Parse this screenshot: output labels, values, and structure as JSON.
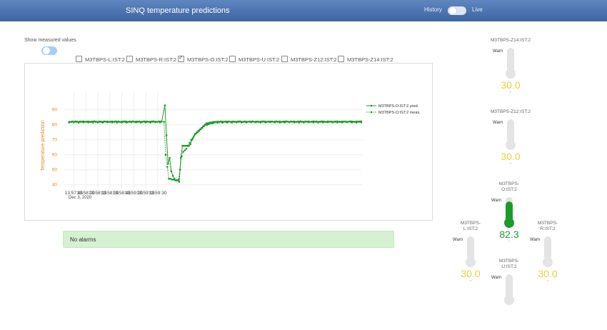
{
  "header": {
    "title": "SINQ temperature predictions",
    "mode_left": "History",
    "mode_right": "Live"
  },
  "controls": {
    "show_measured_label": "Show measured values",
    "show_measured_on": true,
    "sensors": [
      {
        "label": "M3TBPS-L:IST:2",
        "checked": false
      },
      {
        "label": "M3TBPS-R:IST:2",
        "checked": false
      },
      {
        "label": "M3TBPS-O:IST:2",
        "checked": true
      },
      {
        "label": "M3TBPS-U:IST:2",
        "checked": false
      },
      {
        "label": "M3TBPS-Z12:IST:2",
        "checked": false
      },
      {
        "label": "M3TBPS-Z14:IST:2",
        "checked": false
      }
    ]
  },
  "chart_data": {
    "type": "line",
    "ylabel": "Temperature prediction",
    "ylim": [
      37,
      97
    ],
    "yticks": [
      "40",
      "50",
      "60",
      "70",
      "80",
      "90"
    ],
    "xticks": [
      "13:57:45",
      "13:58:00",
      "13:58:15",
      "13:58:30",
      "13:58:45",
      "13:59:00",
      "13:59:15",
      "13:59:30"
    ],
    "xdate": "Dec 3, 2020",
    "x_unit": "seconds after 13:57:45",
    "grid": true,
    "legend_position": "top-right",
    "series_color": "#1e9a2a",
    "series": [
      {
        "name": "M3TBPS-O:IST:2 pred.",
        "style": "solid",
        "x": [
          -6,
          -4,
          -2,
          0,
          2,
          4,
          6,
          8,
          10,
          12,
          14,
          16,
          18,
          20,
          22,
          24,
          26,
          28,
          30,
          32,
          34,
          36,
          38,
          40,
          42,
          44,
          46,
          48,
          50,
          52,
          54,
          56,
          58,
          60,
          62,
          64,
          66,
          68,
          70,
          72,
          74,
          76,
          78,
          80,
          82,
          84,
          86,
          88,
          90,
          92,
          94,
          96,
          98,
          100,
          102,
          104,
          106,
          108,
          110,
          114,
          116,
          118,
          120,
          122,
          124,
          126,
          128,
          130,
          132,
          134,
          136,
          138,
          140,
          142,
          144,
          146,
          148,
          150,
          152,
          154,
          156,
          158,
          160,
          162,
          164,
          166,
          168,
          170,
          172,
          174,
          176,
          178,
          180,
          182,
          184,
          186,
          188,
          190,
          192,
          194,
          196,
          198,
          200,
          202,
          204,
          206,
          208,
          210,
          212,
          214,
          216,
          218,
          220,
          222,
          224,
          226,
          228,
          230,
          232,
          234,
          236,
          238,
          240,
          242,
          244,
          246,
          248,
          250,
          252,
          254,
          256,
          258,
          260,
          262,
          264,
          266,
          268,
          270,
          272,
          274,
          276,
          278,
          280,
          282,
          284,
          286,
          288,
          290,
          292,
          294,
          296,
          298,
          300,
          302,
          304,
          306,
          308,
          310,
          312,
          314,
          316,
          318,
          320,
          322,
          324,
          326,
          328,
          330,
          332,
          334,
          336,
          338,
          340,
          342,
          344,
          346,
          348,
          350,
          352,
          354,
          356,
          358,
          360
        ],
        "values": [
          82,
          82,
          82.2,
          82,
          82.3,
          82.1,
          82,
          82.2,
          82.1,
          82.3,
          82,
          82.1,
          82.2,
          82,
          82.1,
          82.2,
          82.3,
          82.1,
          82,
          82.2,
          82.1,
          82,
          82.3,
          82.1,
          82.2,
          82,
          82.1,
          82.2,
          82,
          82.3,
          82.1,
          82.2,
          82.0,
          82.1,
          82.2,
          82.3,
          82.1,
          82,
          82.2,
          82.1,
          82.3,
          82,
          82.2,
          82.1,
          82.2,
          82,
          82.1,
          82.3,
          82.1,
          82.2,
          82,
          82.1,
          82.2,
          82.3,
          82.1,
          82,
          82.2,
          82.1,
          82.2,
          93,
          73,
          54,
          58,
          49,
          46,
          44,
          43,
          43,
          42,
          58,
          66,
          66,
          66,
          66,
          66,
          67,
          70,
          72,
          74,
          75,
          76,
          77,
          78,
          79,
          80,
          81,
          81,
          81.5,
          81.5,
          81.8,
          82,
          82,
          82.1,
          82,
          82.2,
          82.1,
          82,
          82.2,
          82.1,
          82.3,
          82,
          82.1,
          82.2,
          82,
          82.1,
          82.2,
          82.3,
          82.1,
          82,
          82.2,
          82.1,
          82,
          82.2,
          82.1,
          82.3,
          82,
          82.1,
          82.2,
          82,
          82.1,
          82.2,
          82.3,
          82.1,
          82,
          82.2,
          82.1,
          82.2,
          82,
          82.1,
          82.3,
          82.1,
          82.2,
          82,
          82.1,
          82.2,
          82.3,
          82.1,
          82,
          82.2,
          82.1,
          82.2,
          82,
          82.1,
          82.2,
          82.3,
          82.1,
          82,
          82.2,
          82.1,
          82.2,
          82,
          82.1,
          82.3,
          82.1,
          82.2,
          82,
          82.1,
          82.2,
          82.3,
          82.1,
          82,
          82.2,
          82.1,
          82.2,
          82,
          82.1,
          82.2,
          82.3,
          82.1,
          82,
          82.2,
          82.1,
          82.2,
          82,
          82.1,
          82.2,
          82.3,
          82.1,
          82,
          82.2,
          82.1,
          82.2,
          82.3
        ]
      },
      {
        "name": "M3TBPS-O:IST:2 meas.",
        "style": "dotted",
        "x": [
          -6,
          0,
          6,
          12,
          18,
          24,
          30,
          36,
          42,
          48,
          54,
          60,
          66,
          72,
          78,
          84,
          90,
          96,
          102,
          108,
          113,
          115,
          117,
          119,
          121,
          123,
          125,
          127,
          129,
          131,
          133,
          135,
          137,
          139,
          141,
          143,
          145,
          147,
          149,
          151,
          153,
          155,
          157,
          159,
          161,
          163,
          165,
          167,
          169,
          171,
          173,
          175,
          180,
          186,
          192,
          198,
          204,
          210,
          216,
          222,
          228,
          234,
          240,
          246,
          252,
          258,
          264,
          270,
          276,
          282,
          288,
          294,
          300,
          306,
          312,
          318,
          324,
          330,
          336,
          342,
          348,
          354,
          360
        ],
        "values": [
          81.5,
          81.6,
          81.5,
          81.7,
          81.6,
          81.5,
          81.6,
          81.5,
          81.7,
          81.6,
          81.5,
          81.6,
          81.5,
          81.7,
          81.6,
          81.5,
          81.6,
          81.5,
          81.7,
          81.6,
          82,
          60,
          52,
          44,
          44,
          43.5,
          43.5,
          43,
          43,
          43.5,
          50,
          59,
          62,
          63,
          64,
          66,
          68,
          70,
          71,
          73,
          74,
          75,
          76,
          77,
          78,
          79,
          80,
          80,
          80.5,
          81,
          81,
          81.2,
          81.3,
          81.4,
          81.5,
          81.5,
          81.6,
          81.5,
          81.6,
          81.7,
          81.6,
          81.5,
          81.6,
          81.7,
          81.6,
          81.5,
          81.6,
          81.7,
          81.6,
          81.5,
          81.6,
          81.7,
          81.6,
          81.5,
          81.6,
          81.7,
          81.6,
          81.5,
          81.6,
          81.7,
          81.6,
          81.5,
          81.6
        ]
      }
    ]
  },
  "alarms": {
    "text": "No alarms"
  },
  "gauges": [
    {
      "id": "z14",
      "name": "M3TBPS-Z14:IST:2",
      "warn": "Warn",
      "value": "30.0",
      "unit": "°",
      "fill": 0,
      "color": "#e8d23a"
    },
    {
      "id": "z12",
      "name": "M3TBPS-Z12:IST:2",
      "warn": "Warn",
      "value": "30.0",
      "unit": "°",
      "fill": 0,
      "color": "#e8d23a"
    },
    {
      "id": "o",
      "name": "M3TBPS-O:IST:2",
      "warn": "Warn",
      "value": "82.3",
      "unit": "°",
      "fill": 0.82,
      "color": "#1e9a2a"
    },
    {
      "id": "l",
      "name": "M3TBPS-L:IST:2",
      "warn": "Warn",
      "value": "30.0",
      "unit": "°",
      "fill": 0,
      "color": "#e8d23a"
    },
    {
      "id": "r",
      "name": "M3TBPS-R:IST:2",
      "warn": "Warn",
      "value": "30.0",
      "unit": "°",
      "fill": 0,
      "color": "#e8d23a"
    },
    {
      "id": "u",
      "name": "M3TBPS-U:IST:2",
      "warn": "Warn",
      "value": "",
      "unit": "",
      "fill": 0,
      "color": "#e8d23a"
    }
  ]
}
